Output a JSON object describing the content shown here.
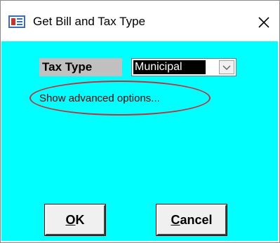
{
  "window": {
    "title": "Get Bill and Tax Type",
    "close_glyph": "✕",
    "icon": "form-window-icon"
  },
  "form": {
    "tax_type_label": "Tax Type",
    "tax_type_value": "Municipal",
    "advanced_link": "Show advanced options...",
    "background_color": "#00ffff"
  },
  "buttons": {
    "ok": {
      "mnemonic": "O",
      "rest": "K"
    },
    "cancel": {
      "mnemonic": "C",
      "rest": "ancel"
    }
  },
  "annotation": {
    "color": "#c0303c",
    "shape": "ellipse"
  }
}
